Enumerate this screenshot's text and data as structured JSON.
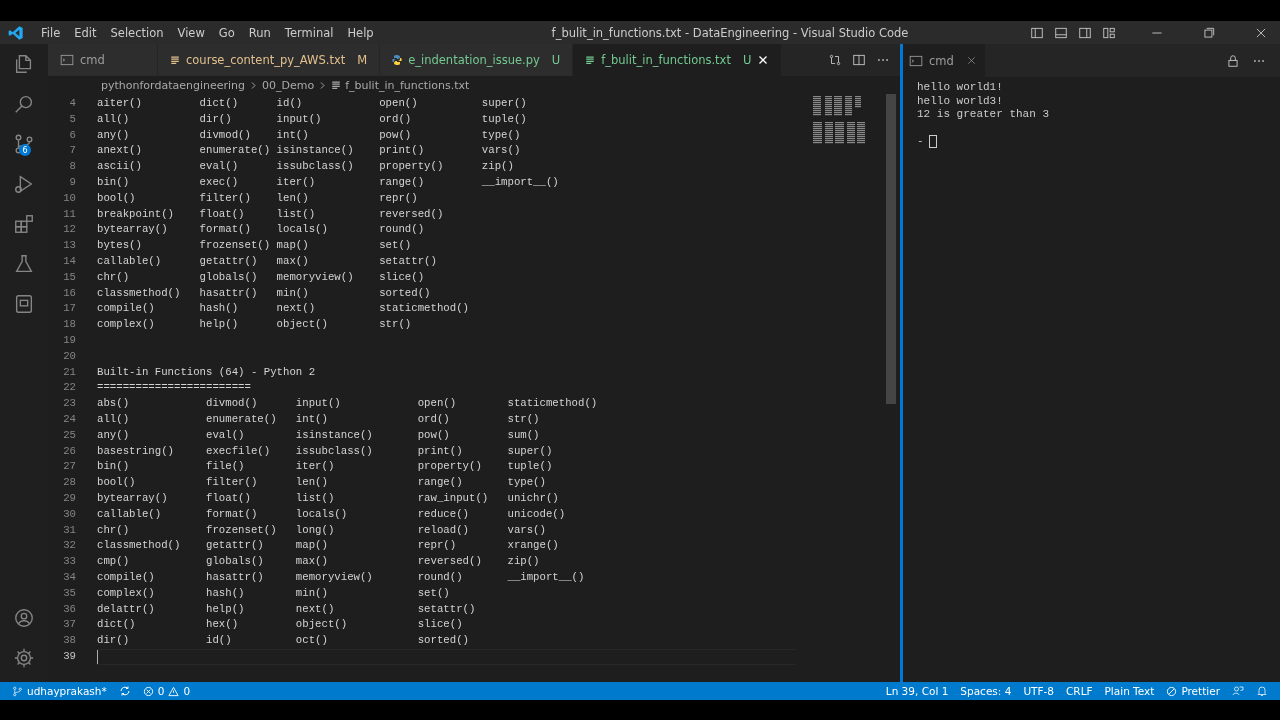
{
  "window": {
    "title": "f_bulit_in_functions.txt - DataEngineering - Visual Studio Code"
  },
  "menu": [
    "File",
    "Edit",
    "Selection",
    "View",
    "Go",
    "Run",
    "Terminal",
    "Help"
  ],
  "activity_bar": {
    "source_control_badge": "6"
  },
  "tabs": [
    {
      "label": "cmd",
      "kind": "terminal",
      "selected": false
    },
    {
      "label": "course_content_py_AWS.txt",
      "kind": "text",
      "status": "M",
      "color": "#e2c08d",
      "selected": false
    },
    {
      "label": "e_indentation_issue.py",
      "kind": "python",
      "status": "U",
      "color": "#73c991",
      "selected": false
    },
    {
      "label": "f_bulit_in_functions.txt",
      "kind": "text",
      "status": "U",
      "color": "#73c991",
      "selected": true
    }
  ],
  "breadcrumb": [
    "pythonfordataengineering",
    "00_Demo",
    "f_bulit_in_functions.txt"
  ],
  "editor": {
    "lines": [
      {
        "number": "4",
        "text": "aiter()         dict()      id()            open()          super()",
        "current": false
      },
      {
        "number": "5",
        "text": "all()           dir()       input()         ord()           tuple()",
        "current": false
      },
      {
        "number": "6",
        "text": "any()           divmod()    int()           pow()           type()",
        "current": false
      },
      {
        "number": "7",
        "text": "anext()         enumerate() isinstance()    print()         vars()",
        "current": false
      },
      {
        "number": "8",
        "text": "ascii()         eval()      issubclass()    property()      zip()",
        "current": false
      },
      {
        "number": "9",
        "text": "bin()           exec()      iter()          range()         __import__()",
        "current": false
      },
      {
        "number": "10",
        "text": "bool()          filter()    len()           repr()",
        "current": false
      },
      {
        "number": "11",
        "text": "breakpoint()    float()     list()          reversed()",
        "current": false
      },
      {
        "number": "12",
        "text": "bytearray()     format()    locals()        round()",
        "current": false
      },
      {
        "number": "13",
        "text": "bytes()         frozenset() map()           set()",
        "current": false
      },
      {
        "number": "14",
        "text": "callable()      getattr()   max()           setattr()",
        "current": false
      },
      {
        "number": "15",
        "text": "chr()           globals()   memoryview()    slice()",
        "current": false
      },
      {
        "number": "16",
        "text": "classmethod()   hasattr()   min()           sorted()",
        "current": false
      },
      {
        "number": "17",
        "text": "compile()       hash()      next()          staticmethod()",
        "current": false
      },
      {
        "number": "18",
        "text": "complex()       help()      object()        str()",
        "current": false
      },
      {
        "number": "19",
        "current": false
      },
      {
        "number": "20",
        "current": false
      },
      {
        "number": "21",
        "text": "Built-in Functions (64) - Python 2",
        "current": false
      },
      {
        "number": "22",
        "text": "========================",
        "current": false
      },
      {
        "number": "23",
        "text": "abs()            divmod()      input()            open()        staticmethod()",
        "current": false
      },
      {
        "number": "24",
        "text": "all()            enumerate()   int()              ord()         str()",
        "current": false
      },
      {
        "number": "25",
        "text": "any()            eval()        isinstance()       pow()         sum()",
        "current": false
      },
      {
        "number": "26",
        "text": "basestring()     execfile()    issubclass()       print()       super()",
        "current": false
      },
      {
        "number": "27",
        "text": "bin()            file()        iter()             property()    tuple()",
        "current": false
      },
      {
        "number": "28",
        "text": "bool()           filter()      len()              range()       type()",
        "current": false
      },
      {
        "number": "29",
        "text": "bytearray()      float()       list()             raw_input()   unichr()",
        "current": false
      },
      {
        "number": "30",
        "text": "callable()       format()      locals()           reduce()      unicode()",
        "current": false
      },
      {
        "number": "31",
        "text": "chr()            frozenset()   long()             reload()      vars()",
        "current": false
      },
      {
        "number": "32",
        "text": "classmethod()    getattr()     map()              repr()        xrange()",
        "current": false
      },
      {
        "number": "33",
        "text": "cmp()            globals()     max()              reversed()    zip()",
        "current": false
      },
      {
        "number": "34",
        "text": "compile()        hasattr()     memoryview()       round()       __import__()",
        "current": false
      },
      {
        "number": "35",
        "text": "complex()        hash()        min()              set()",
        "current": false
      },
      {
        "number": "36",
        "text": "delattr()        help()        next()             setattr()",
        "current": false
      },
      {
        "number": "37",
        "text": "dict()           hex()         object()           slice()",
        "current": false
      },
      {
        "number": "38",
        "text": "dir()            id()          oct()              sorted()",
        "current": false
      },
      {
        "number": "39",
        "current": true
      }
    ]
  },
  "terminal": {
    "tab": "cmd",
    "lines": [
      "hello world1!",
      "hello world3!",
      "12 is greater than 3"
    ],
    "prompt": "-"
  },
  "status_bar": {
    "branch": "udhayprakash*",
    "errors": "0",
    "warnings": "0",
    "items": [
      "Ln 39, Col 1",
      "Spaces: 4",
      "UTF-8",
      "CRLF",
      "Plain Text"
    ],
    "formatter": "Prettier"
  }
}
